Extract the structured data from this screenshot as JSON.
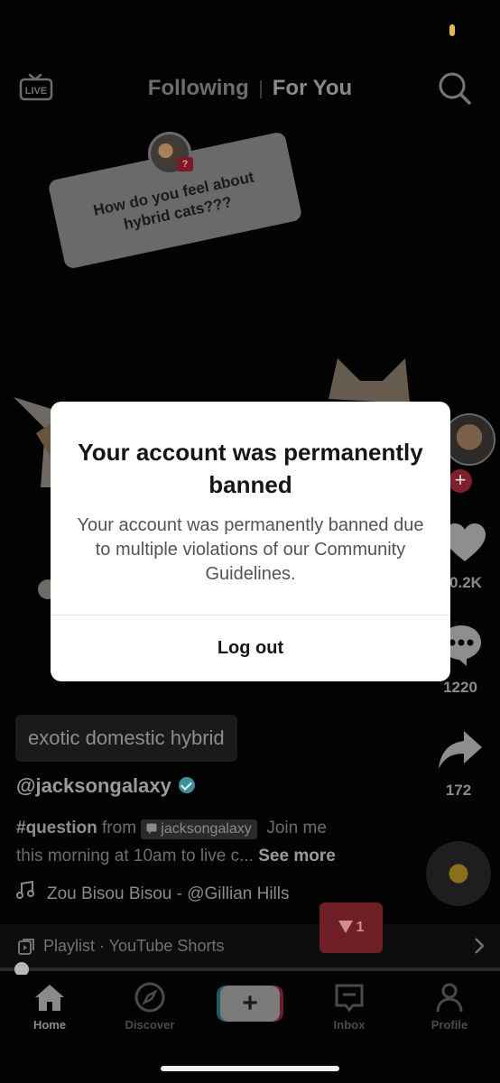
{
  "top_nav": {
    "live_label": "LIVE",
    "tabs": [
      "Following",
      "For You"
    ],
    "active_tab": "For You"
  },
  "question_sticker": {
    "text": "How do you feel about hybrid cats???",
    "badge": "?"
  },
  "right_rail": {
    "likes": "0.2K",
    "comments": "1220",
    "shares": "172"
  },
  "caption": {
    "tag": "exotic domestic hybrid",
    "username": "@jacksongalaxy",
    "hashtag": "#question",
    "from": "from",
    "chip_user": "jacksongalaxy",
    "text_line1": "Join me",
    "text_line2": "this morning at 10am to live c...",
    "see_more": "See more",
    "music": "Zou Bisou Bisou - @Gillian Hills"
  },
  "playlist": {
    "label": "Playlist · YouTube Shorts"
  },
  "inbox_bubble": {
    "count": "1"
  },
  "bottom_nav": {
    "items": [
      "Home",
      "Discover",
      "Inbox",
      "Profile"
    ]
  },
  "modal": {
    "title": "Your account was permanently banned",
    "body": "Your account was permanently banned due to multiple violations of our Community Guidelines.",
    "action": "Log out"
  },
  "colors": {
    "accent_red": "#fe2c55",
    "accent_cyan": "#25f4ee",
    "modal_bg": "#ffffff"
  }
}
